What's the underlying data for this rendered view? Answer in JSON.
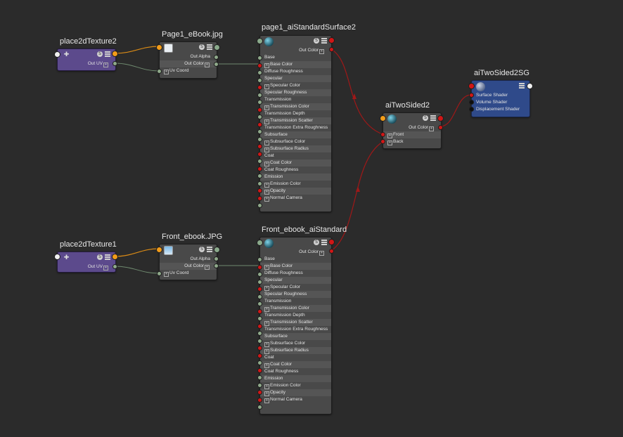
{
  "nodes": {
    "place2dTexture2": {
      "title": "place2dTexture2",
      "outputs": [
        "Out UV"
      ]
    },
    "page1_ebook": {
      "title": "Page1_eBook.jpg",
      "outputs": [
        "Out Alpha",
        "Out Color"
      ],
      "inputs": [
        "Uv Coord"
      ]
    },
    "page1_surface": {
      "title": "page1_aiStandardSurface2",
      "output": "Out Color",
      "attrs": [
        "Base",
        "Base Color",
        "Diffuse Roughness",
        "Specular",
        "Specular Color",
        "Specular Roughness",
        "Transmission",
        "Transmission Color",
        "Transmission Depth",
        "Transmission Scatter",
        "Transmission Extra Roughness",
        "Subsurface",
        "Subsurface Color",
        "Subsurface Radius",
        "Coat",
        "Coat Color",
        "Coat Roughness",
        "Emission",
        "Emission Color",
        "Opacity",
        "Normal Camera"
      ]
    },
    "place2dTexture1": {
      "title": "place2dTexture1",
      "outputs": [
        "Out UV"
      ]
    },
    "front_ebook": {
      "title": "Front_ebook.JPG",
      "outputs": [
        "Out Alpha",
        "Out Color"
      ],
      "inputs": [
        "Uv Coord"
      ]
    },
    "front_surface": {
      "title": "Front_ebook_aiStandard",
      "output": "Out Color",
      "attrs": [
        "Base",
        "Base Color",
        "Diffuse Roughness",
        "Specular",
        "Specular Color",
        "Specular Roughness",
        "Transmission",
        "Transmission Color",
        "Transmission Depth",
        "Transmission Scatter",
        "Transmission Extra Roughness",
        "Subsurface",
        "Subsurface Color",
        "Subsurface Radius",
        "Coat",
        "Coat Color",
        "Coat Roughness",
        "Emission",
        "Emission Color",
        "Opacity",
        "Normal Camera"
      ]
    },
    "aiTwoSided2": {
      "title": "aiTwoSided2",
      "output": "Out Color",
      "inputs": [
        "Front",
        "Back"
      ]
    },
    "aiTwoSided2SG": {
      "title": "aiTwoSided2SG",
      "inputs": [
        "Surface Shader",
        "Volume Shader",
        "Displacement Shader"
      ]
    }
  },
  "colors": {
    "background": "#2b2b2b",
    "node": "#494949",
    "place2d_node": "#5c4a8c",
    "shading_group": "#2f4a8a",
    "wire_color": "#a01818",
    "wire_uv": "#6f8a6f",
    "wire_orange": "#d98a16"
  }
}
